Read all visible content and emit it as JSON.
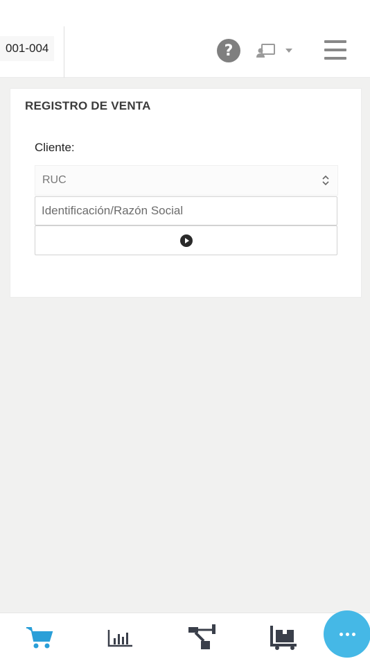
{
  "header": {
    "terminal_code": "001-004",
    "help_icon": "question-circle-icon",
    "user_icon": "user-card-icon",
    "menu_icon": "hamburger-icon"
  },
  "card": {
    "title": "REGISTRO DE VENTA",
    "client_label": "Cliente:",
    "doc_type_value": "RUC",
    "id_placeholder": "Identificación/Razón Social",
    "search_icon": "play-circle-icon"
  },
  "bottom_nav": {
    "items": [
      {
        "icon": "cart-icon",
        "active": true
      },
      {
        "icon": "bar-chart-icon",
        "active": false
      },
      {
        "icon": "hierarchy-icon",
        "active": false
      },
      {
        "icon": "inventory-cart-icon",
        "active": false
      }
    ],
    "more_icon": "more-dots-icon"
  },
  "colors": {
    "accent": "#45b8e6",
    "active_nav": "#2a9fd8",
    "inactive_nav": "#3a3f4a",
    "background": "#f1f1f0"
  }
}
